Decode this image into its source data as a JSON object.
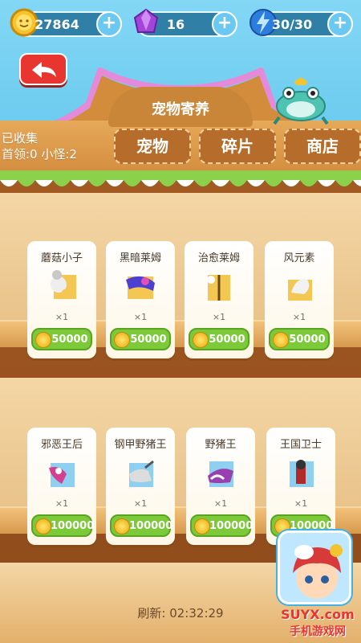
{
  "currencies": {
    "coins": "27864",
    "gems": "16",
    "energy": "30/30"
  },
  "header": {
    "title": "宠物寄养"
  },
  "collection": {
    "line1": "已收集",
    "line2": "首领:0 小怪:2"
  },
  "tabs": [
    {
      "label": "宠物"
    },
    {
      "label": "碎片"
    },
    {
      "label": "商店"
    }
  ],
  "shelf1": [
    {
      "name": "蘑菇小子",
      "count": "×1",
      "price": "50000"
    },
    {
      "name": "黑暗莱姆",
      "count": "×1",
      "price": "50000"
    },
    {
      "name": "治愈莱姆",
      "count": "×1",
      "price": "50000"
    },
    {
      "name": "风元素",
      "count": "×1",
      "price": "50000"
    }
  ],
  "shelf2": [
    {
      "name": "邪恶王后",
      "count": "×1",
      "price": "100000"
    },
    {
      "name": "钢甲野猪王",
      "count": "×1",
      "price": "100000"
    },
    {
      "name": "野猪王",
      "count": "×1",
      "price": "100000"
    },
    {
      "name": "王国卫士",
      "count": "×1",
      "price": "100000"
    }
  ],
  "refresh": "刷新:  02:32:29",
  "watermark": {
    "line1": "SUYX.com",
    "line2": "手机游戏网"
  },
  "colors": {
    "accent_red": "#e8352f",
    "price_green": "#7cc93a",
    "frame_pink": "#e58ad8"
  }
}
